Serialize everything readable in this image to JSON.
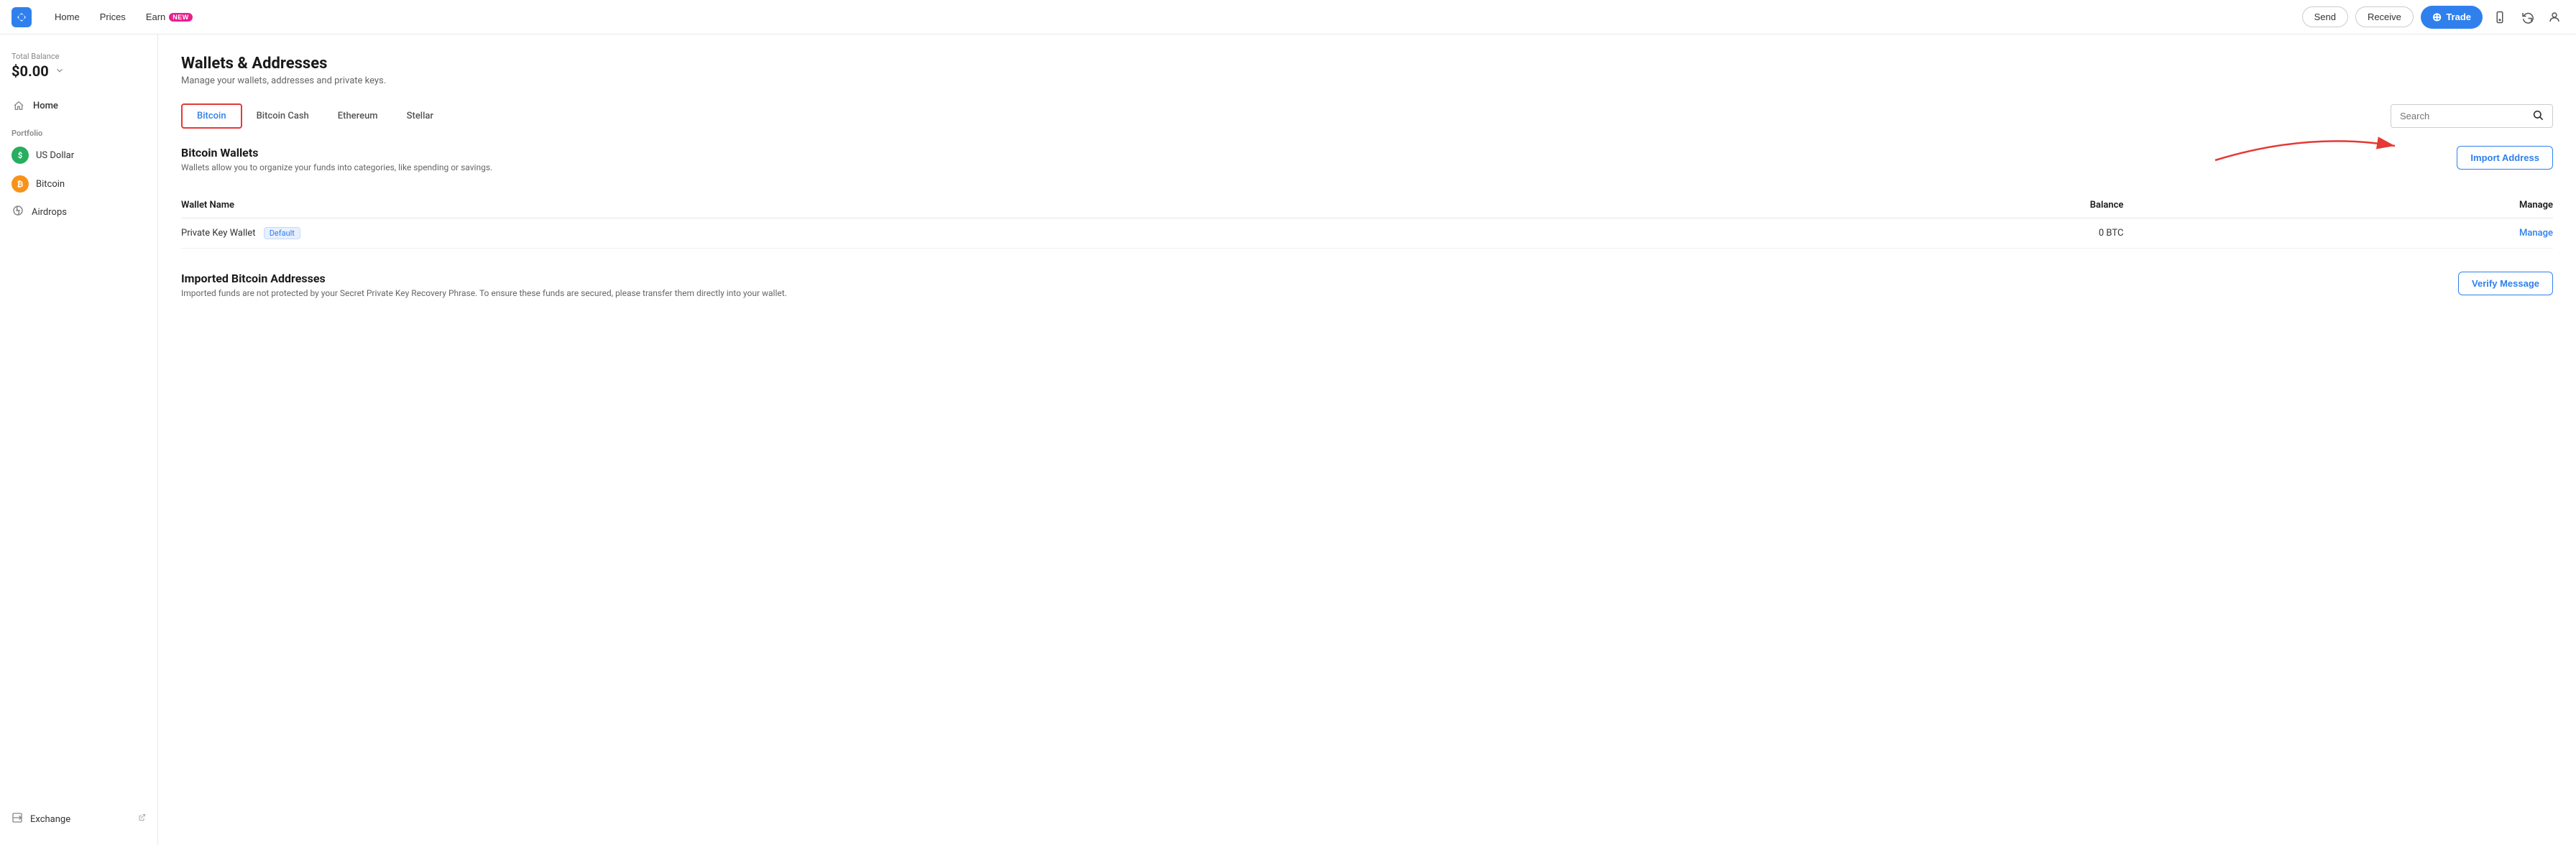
{
  "app": {
    "logo_alt": "App Logo"
  },
  "topnav": {
    "home_label": "Home",
    "prices_label": "Prices",
    "earn_label": "Earn",
    "earn_badge": "NEW",
    "send_label": "Send",
    "receive_label": "Receive",
    "trade_label": "Trade"
  },
  "sidebar": {
    "balance_label": "Total Balance",
    "balance_amount": "$0.00",
    "home_label": "Home",
    "portfolio_label": "Portfolio",
    "usd_label": "US Dollar",
    "bitcoin_label": "Bitcoin",
    "airdrops_label": "Airdrops",
    "exchange_label": "Exchange"
  },
  "page": {
    "title": "Wallets & Addresses",
    "subtitle": "Manage your wallets, addresses and private keys.",
    "tabs": [
      {
        "id": "bitcoin",
        "label": "Bitcoin",
        "active": true
      },
      {
        "id": "bitcoin-cash",
        "label": "Bitcoin Cash",
        "active": false
      },
      {
        "id": "ethereum",
        "label": "Ethereum",
        "active": false
      },
      {
        "id": "stellar",
        "label": "Stellar",
        "active": false
      }
    ],
    "search_placeholder": "Search"
  },
  "wallets_section": {
    "title": "Bitcoin Wallets",
    "subtitle": "Wallets allow you to organize your funds into categories, like spending or savings.",
    "import_button": "Import Address",
    "table_headers": {
      "wallet_name": "Wallet Name",
      "balance": "Balance",
      "manage": "Manage"
    },
    "rows": [
      {
        "name": "Private Key Wallet",
        "badge": "Default",
        "balance": "0 BTC",
        "manage_link": "Manage"
      }
    ]
  },
  "imported_section": {
    "title": "Imported Bitcoin Addresses",
    "subtitle": "Imported funds are not protected by your Secret Private Key Recovery Phrase. To ensure these funds are secured, please transfer them directly into your wallet.",
    "verify_button": "Verify Message"
  }
}
